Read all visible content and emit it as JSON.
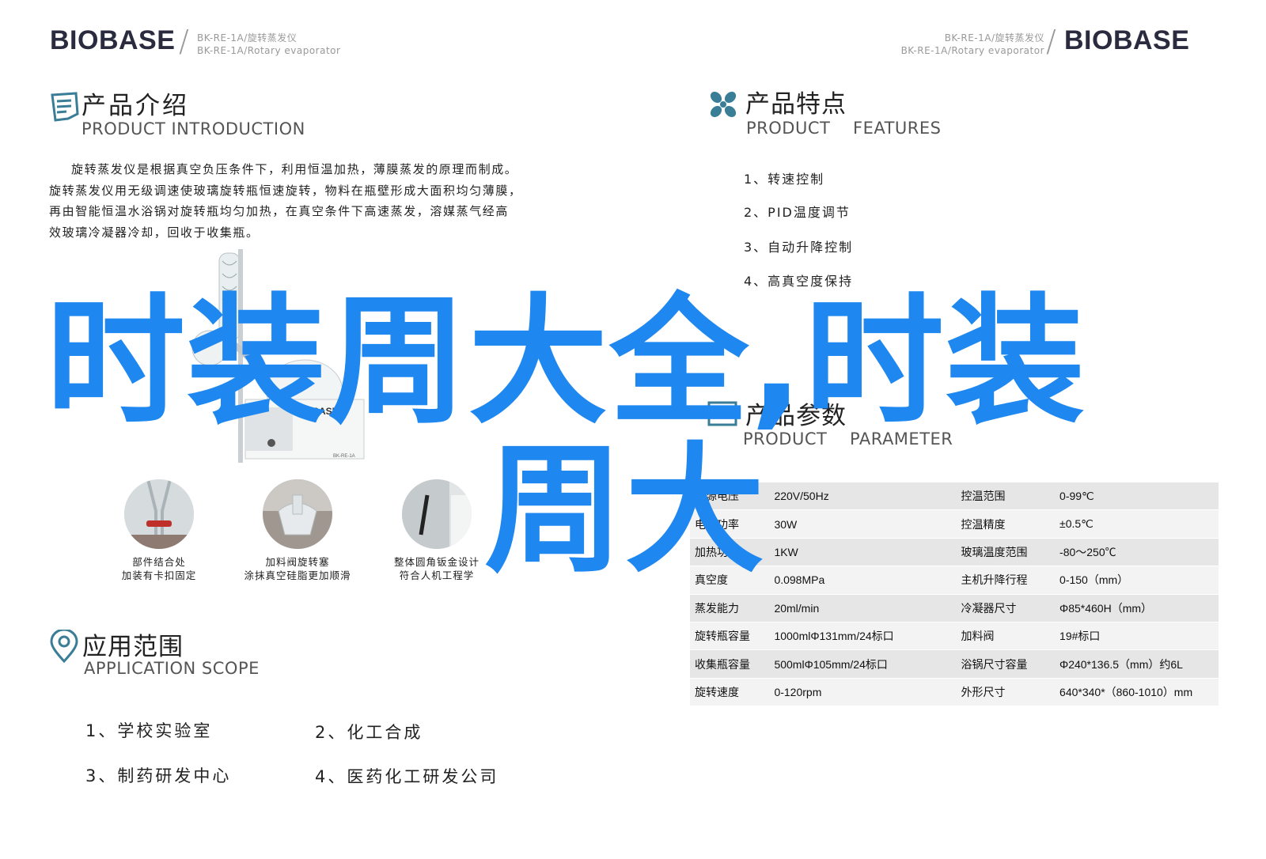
{
  "header_left": {
    "logo": "BIOBASE",
    "model_cn": "BK-RE-1A/旋转蒸发仪",
    "model_en": "BK-RE-1A/Rotary evaporator"
  },
  "header_right": {
    "logo": "BIOBASE",
    "model_cn": "BK-RE-1A/旋转蒸发仪",
    "model_en": "BK-RE-1A/Rotary evaporator"
  },
  "intro": {
    "title_cn": "产品介绍",
    "title_en": "PRODUCT  INTRODUCTION",
    "lines": [
      "旋转蒸发仪是根据真空负压条件下，利用恒温加热，薄膜蒸发的原理而制成。",
      "旋转蒸发仪用无级调速使玻璃旋转瓶恒速旋转，物料在瓶壁形成大面积均匀薄膜，",
      "再由智能恒温水浴锅对旋转瓶均匀加热，在真空条件下高速蒸发，溶媒蒸气经高",
      "效玻璃冷凝器冷却，回收于收集瓶。"
    ]
  },
  "device": {
    "badge": "BIOBASE",
    "model": "BK-RE-1A"
  },
  "details": [
    {
      "line1": "部件结合处",
      "line2": "加装有卡扣固定"
    },
    {
      "line1": "加料阀旋转塞",
      "line2": "涂抹真空硅脂更加顺滑"
    },
    {
      "line1": "整体圆角钣金设计",
      "line2": "符合人机工程学"
    }
  ],
  "features": {
    "title_cn": "产品特点",
    "title_en": "PRODUCT    FEATURES",
    "items": [
      "1、转速控制",
      "2、PID温度调节",
      "3、自动升降控制",
      "4、高真空度保持"
    ]
  },
  "parameters": {
    "title_cn": "产品参数",
    "title_en": "PRODUCT    PARAMETER",
    "rows": [
      [
        "电源电压",
        "220V/50Hz",
        "控温范围",
        "0-99℃"
      ],
      [
        "电机功率",
        "30W",
        "控温精度",
        "±0.5℃"
      ],
      [
        "加热功率",
        "1KW",
        "玻璃温度范围",
        "-80～250℃"
      ],
      [
        "真空度",
        "0.098MPa",
        "主机升降行程",
        "0-150（mm）"
      ],
      [
        "蒸发能力",
        "20ml/min",
        "冷凝器尺寸",
        "Φ85*460H（mm）"
      ],
      [
        "旋转瓶容量",
        "1000mlΦ131mm/24标口",
        "加料阀",
        "19#标口"
      ],
      [
        "收集瓶容量",
        "500mlΦ105mm/24标口",
        "浴锅尺寸容量",
        "Φ240*136.5（mm）约6L"
      ],
      [
        "旋转速度",
        "0-120rpm",
        "外形尺寸",
        "640*340*（860-1010）mm"
      ]
    ]
  },
  "scope": {
    "title_cn": "应用范围",
    "title_en": "APPLICATION   SCOPE",
    "items": [
      "1、学校实验室",
      "2、化工合成",
      "3、制药研发中心",
      "4、医药化工研发公司"
    ]
  },
  "overlay": {
    "line1": "时装周大全,时装",
    "line2": "周大"
  },
  "colors": {
    "overlay_blue": "#1e87f0",
    "icon_teal": "#3a7d96",
    "logo_dark": "#2b2b3f"
  }
}
